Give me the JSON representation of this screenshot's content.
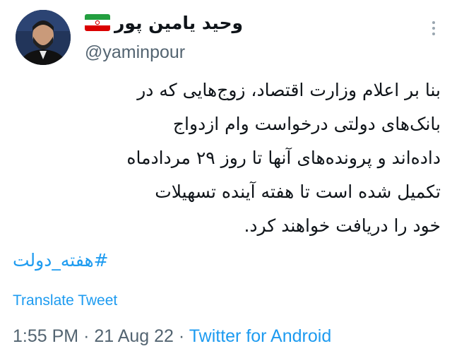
{
  "author": {
    "display_name": "وحید یامین پور",
    "handle": "@yaminpour",
    "flag_icon": "iran-flag-icon"
  },
  "tweet": {
    "text_lines": [
      "بنا بر اعلام وزارت اقتصاد، زوج‌هایی که در",
      "بانک‌های دولتی درخواست وام ازدواج",
      "داده‌اند و پرونده‌های آنها تا روز ۲۹ مردادماه",
      "تکمیل شده است تا هفته آینده تسهیلات",
      "خود را دریافت خواهند کرد."
    ],
    "hashtag": "#هفته_دولت"
  },
  "translate_label": "Translate Tweet",
  "meta": {
    "time": "1:55 PM",
    "separator": "·",
    "date": "21 Aug 22",
    "source": "Twitter for Android"
  },
  "colors": {
    "accent": "#1d9bf0",
    "text": "#0f1419",
    "muted": "#536471"
  }
}
